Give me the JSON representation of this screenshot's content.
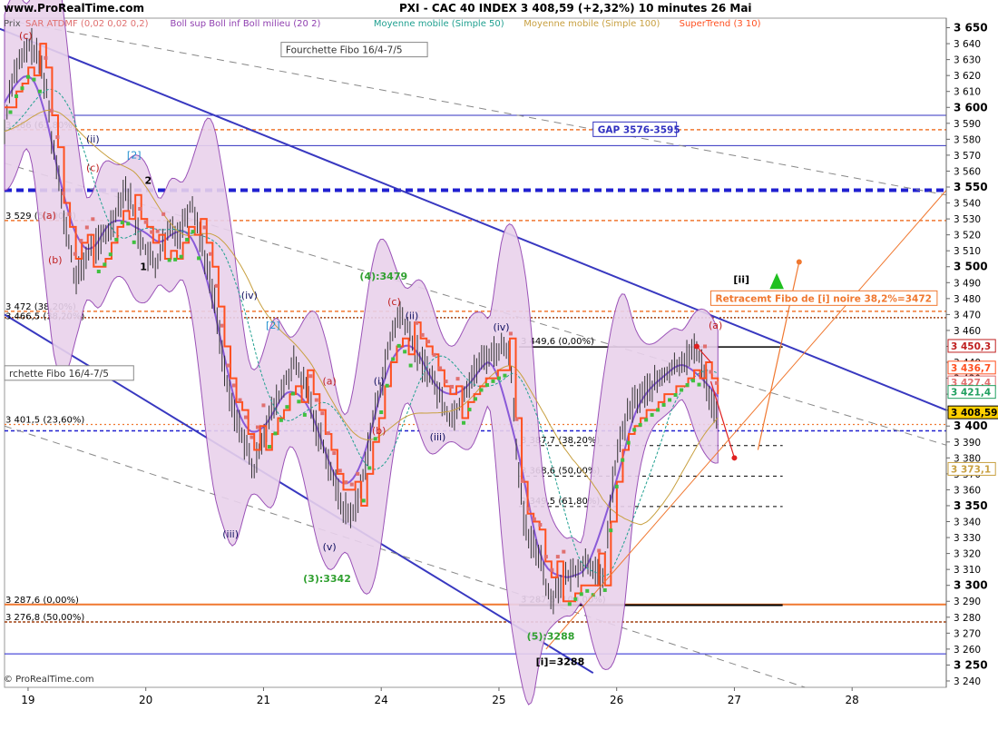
{
  "header": {
    "site": "www.ProRealTime.com",
    "title": "PXI - CAC 40 INDEX     3 408,59  (+2,32%)     10 minutes  26 Mai",
    "price_label": "Prix",
    "footer": "© ProRealTime.com"
  },
  "legend": [
    {
      "label": "SAR ATDMF (0,02 0,02 0,2)",
      "color": "#e07070"
    },
    {
      "label": "Boll sup Boll inf Boll milieu (20 2)",
      "color": "#9040b0"
    },
    {
      "label": "Moyenne mobile (Simple 50)",
      "color": "#20a090"
    },
    {
      "label": "Moyenne mobile (Simple 100)",
      "color": "#c8a040"
    },
    {
      "label": "SuperTrend (3 10)",
      "color": "#ff5020"
    }
  ],
  "chart_data": {
    "type": "line",
    "title": "PXI - CAC 40 INDEX",
    "x_ticks": [
      "19",
      "20",
      "21",
      "24",
      "25",
      "26",
      "27",
      "28"
    ],
    "y_ticks": [
      3240,
      3250,
      3260,
      3270,
      3280,
      3290,
      3300,
      3310,
      3320,
      3330,
      3340,
      3350,
      3360,
      3370,
      3380,
      3390,
      3400,
      3410,
      3420,
      3430,
      3440,
      3450,
      3460,
      3470,
      3480,
      3490,
      3500,
      3510,
      3520,
      3530,
      3540,
      3550,
      3560,
      3570,
      3580,
      3590,
      3600,
      3610,
      3620,
      3630,
      3640,
      3650
    ],
    "y_bold_ticks": [
      3250,
      3300,
      3350,
      3400,
      3450,
      3500,
      3550,
      3600,
      3650
    ],
    "ylim": [
      3236,
      3656
    ],
    "xlim": [
      0,
      8
    ],
    "price_path": [
      [
        0.0,
        3585
      ],
      [
        0.05,
        3615
      ],
      [
        0.1,
        3625
      ],
      [
        0.15,
        3630
      ],
      [
        0.22,
        3640
      ],
      [
        0.3,
        3628
      ],
      [
        0.36,
        3610
      ],
      [
        0.4,
        3580
      ],
      [
        0.46,
        3560
      ],
      [
        0.5,
        3528
      ],
      [
        0.55,
        3515
      ],
      [
        0.6,
        3490
      ],
      [
        0.66,
        3500
      ],
      [
        0.72,
        3510
      ],
      [
        0.8,
        3515
      ],
      [
        0.88,
        3522
      ],
      [
        0.95,
        3535
      ],
      [
        1.02,
        3550
      ],
      [
        1.08,
        3540
      ],
      [
        1.14,
        3520
      ],
      [
        1.2,
        3510
      ],
      [
        1.28,
        3500
      ],
      [
        1.35,
        3515
      ],
      [
        1.42,
        3525
      ],
      [
        1.48,
        3520
      ],
      [
        1.55,
        3535
      ],
      [
        1.6,
        3540
      ],
      [
        1.66,
        3520
      ],
      [
        1.72,
        3500
      ],
      [
        1.78,
        3480
      ],
      [
        1.84,
        3450
      ],
      [
        1.9,
        3420
      ],
      [
        1.96,
        3405
      ],
      [
        2.02,
        3395
      ],
      [
        2.08,
        3380
      ],
      [
        2.12,
        3370
      ],
      [
        2.16,
        3385
      ],
      [
        2.22,
        3400
      ],
      [
        2.28,
        3410
      ],
      [
        2.34,
        3420
      ],
      [
        2.4,
        3430
      ],
      [
        2.46,
        3440
      ],
      [
        2.52,
        3430
      ],
      [
        2.58,
        3420
      ],
      [
        2.64,
        3400
      ],
      [
        2.7,
        3390
      ],
      [
        2.76,
        3375
      ],
      [
        2.82,
        3360
      ],
      [
        2.88,
        3348
      ],
      [
        2.94,
        3344
      ],
      [
        3.0,
        3352
      ],
      [
        3.06,
        3375
      ],
      [
        3.12,
        3400
      ],
      [
        3.18,
        3420
      ],
      [
        3.24,
        3440
      ],
      [
        3.3,
        3460
      ],
      [
        3.36,
        3470
      ],
      [
        3.42,
        3462
      ],
      [
        3.48,
        3450
      ],
      [
        3.54,
        3440
      ],
      [
        3.6,
        3435
      ],
      [
        3.66,
        3425
      ],
      [
        3.72,
        3415
      ],
      [
        3.78,
        3405
      ],
      [
        3.84,
        3410
      ],
      [
        3.9,
        3420
      ],
      [
        3.96,
        3430
      ],
      [
        4.04,
        3440
      ],
      [
        4.12,
        3445
      ],
      [
        4.2,
        3448
      ],
      [
        4.26,
        3450
      ],
      [
        4.3,
        3440
      ],
      [
        4.34,
        3395
      ],
      [
        4.38,
        3360
      ],
      [
        4.42,
        3335
      ],
      [
        4.48,
        3325
      ],
      [
        4.55,
        3320
      ],
      [
        4.6,
        3300
      ],
      [
        4.64,
        3290
      ],
      [
        4.7,
        3300
      ],
      [
        4.78,
        3305
      ],
      [
        4.86,
        3310
      ],
      [
        4.94,
        3315
      ],
      [
        5.0,
        3312
      ],
      [
        5.04,
        3305
      ],
      [
        5.08,
        3300
      ],
      [
        5.12,
        3330
      ],
      [
        5.16,
        3360
      ],
      [
        5.2,
        3380
      ],
      [
        5.26,
        3400
      ],
      [
        5.34,
        3415
      ],
      [
        5.42,
        3420
      ],
      [
        5.5,
        3425
      ],
      [
        5.58,
        3430
      ],
      [
        5.66,
        3435
      ],
      [
        5.74,
        3440
      ],
      [
        5.82,
        3445
      ],
      [
        5.88,
        3448
      ],
      [
        5.92,
        3440
      ],
      [
        5.95,
        3432
      ],
      [
        5.98,
        3420
      ],
      [
        6.02,
        3412
      ],
      [
        6.06,
        3408
      ]
    ],
    "channel_lines": [
      {
        "from": [
          -0.4,
          3660
        ],
        "to": [
          8.0,
          3410
        ],
        "color": "#3838c0",
        "dash": "solid",
        "width": 2
      },
      {
        "from": [
          0.0,
          3470
        ],
        "to": [
          5.0,
          3245
        ],
        "color": "#3838c0",
        "dash": "solid",
        "width": 2
      },
      {
        "from": [
          0.0,
          3565
        ],
        "to": [
          8.0,
          3388
        ],
        "color": "#888888",
        "dash": "8,6",
        "width": 1
      },
      {
        "from": [
          0.0,
          3400
        ],
        "to": [
          6.8,
          3236
        ],
        "color": "#888888",
        "dash": "8,6",
        "width": 1
      },
      {
        "from": [
          0.0,
          3655
        ],
        "to": [
          8.0,
          3545
        ],
        "color": "#888888",
        "dash": "8,6",
        "width": 1
      }
    ],
    "horizontal_levels": [
      {
        "y": 3595,
        "color": "#3030c0",
        "dash": "solid",
        "width": 1
      },
      {
        "y": 3576,
        "color": "#3030c0",
        "dash": "solid",
        "width": 1
      },
      {
        "y": 3586,
        "color": "#f07830",
        "dash": "4,3",
        "width": 1.5
      },
      {
        "y": 3548,
        "color": "#2020d0",
        "dash": "8,5",
        "width": 4
      },
      {
        "y": 3529,
        "color": "#f07830",
        "dash": "4,3",
        "width": 1.5
      },
      {
        "y": 3472,
        "color": "#f07830",
        "dash": "4,3",
        "width": 1.5
      },
      {
        "y": 3468,
        "color": "#a04010",
        "dash": "2,2",
        "width": 1.5
      },
      {
        "y": 3401,
        "color": "#f07830",
        "dash": "2,3",
        "width": 1.2
      },
      {
        "y": 3397,
        "color": "#2020d0",
        "dash": "4,3",
        "width": 1.5
      },
      {
        "y": 3288,
        "color": "#f07830",
        "dash": "solid",
        "width": 2
      },
      {
        "y": 3277,
        "color": "#a04010",
        "dash": "3,2",
        "width": 1.5
      },
      {
        "y": 3257,
        "color": "#2020d0",
        "dash": "solid",
        "width": 1
      }
    ],
    "fib_levels_local": [
      {
        "y": 3449.6,
        "x0": 4.37,
        "x1": 6.61,
        "color": "#000000",
        "width": 1.5,
        "dash": "solid",
        "label": "3 449,6 (0,00%)"
      },
      {
        "y": 3387.7,
        "x0": 4.37,
        "x1": 6.61,
        "color": "#000000",
        "width": 1,
        "dash": "4,4",
        "label": "3 387,7 (38,20%)"
      },
      {
        "y": 3368.6,
        "x0": 4.37,
        "x1": 6.61,
        "color": "#000000",
        "width": 1,
        "dash": "4,4",
        "label": "3 368,6 (50,00%)"
      },
      {
        "y": 3349.5,
        "x0": 4.37,
        "x1": 6.61,
        "color": "#000000",
        "width": 1,
        "dash": "4,4",
        "label": "3 349,5 (61,80%)"
      },
      {
        "y": 3287.6,
        "x0": 4.37,
        "x1": 6.61,
        "color": "#000000",
        "width": 2,
        "dash": "solid",
        "label": "3 287,6 (100,00%)"
      }
    ],
    "left_level_labels": [
      {
        "y": 3586,
        "text": "3 586 (61,80%)"
      },
      {
        "y": 3529,
        "text": "3 529 (50,00%)"
      },
      {
        "y": 3472,
        "text": "3 472 (38,20%)"
      },
      {
        "y": 3466,
        "text": "3 466,5 (38,20%)"
      },
      {
        "y": 3401,
        "text": "3 401,5 (23,60%)"
      },
      {
        "y": 3288,
        "text": "3 287,6 (0,00%)"
      },
      {
        "y": 3277,
        "text": "3 276,8 (50,00%)"
      }
    ],
    "wave_labels": [
      {
        "x": 0.18,
        "y": 3643,
        "text": "(c)",
        "color": "#c02020"
      },
      {
        "x": 0.75,
        "y": 3578,
        "text": "(ii)",
        "color": "#101060"
      },
      {
        "x": 1.1,
        "y": 3568,
        "text": "[2]",
        "color": "#2090d0"
      },
      {
        "x": 0.75,
        "y": 3560,
        "text": "(c)",
        "color": "#c02020"
      },
      {
        "x": 0.38,
        "y": 3530,
        "text": "(a)",
        "color": "#c02020"
      },
      {
        "x": 0.43,
        "y": 3502,
        "text": "(b)",
        "color": "#c02020"
      },
      {
        "x": 1.22,
        "y": 3552,
        "text": "2",
        "color": "#000000"
      },
      {
        "x": 1.18,
        "y": 3498,
        "text": "1",
        "color": "#000000"
      },
      {
        "x": 2.08,
        "y": 3480,
        "text": "(iv)",
        "color": "#101060"
      },
      {
        "x": 2.28,
        "y": 3461,
        "text": "[2]",
        "color": "#2090d0"
      },
      {
        "x": 3.31,
        "y": 3476,
        "text": "(c)",
        "color": "#c02020"
      },
      {
        "x": 3.46,
        "y": 3467,
        "text": "(ii)",
        "color": "#101060"
      },
      {
        "x": 3.18,
        "y": 3395,
        "text": "(b)",
        "color": "#c02020"
      },
      {
        "x": 2.76,
        "y": 3426,
        "text": "(a)",
        "color": "#c02020"
      },
      {
        "x": 3.18,
        "y": 3426,
        "text": "(i)",
        "color": "#101060"
      },
      {
        "x": 3.68,
        "y": 3391,
        "text": "(iii)",
        "color": "#101060"
      },
      {
        "x": 4.22,
        "y": 3460,
        "text": "(iv)",
        "color": "#101060"
      },
      {
        "x": 3.22,
        "y": 3492,
        "text": "(4):3479",
        "color": "#30a030"
      },
      {
        "x": 2.74,
        "y": 3302,
        "text": "(3):3342",
        "color": "#30a030"
      },
      {
        "x": 2.76,
        "y": 3322,
        "text": "(v)",
        "color": "#101060"
      },
      {
        "x": 1.92,
        "y": 3330,
        "text": "(iii)",
        "color": "#101060"
      },
      {
        "x": 4.64,
        "y": 3266,
        "text": "(5):3288",
        "color": "#30a030"
      },
      {
        "x": 4.72,
        "y": 3250,
        "text": "[i]=3288",
        "color": "#000000"
      },
      {
        "x": 6.26,
        "y": 3490,
        "text": "[ii]",
        "color": "#000000"
      },
      {
        "x": 6.04,
        "y": 3461,
        "text": "(a)",
        "color": "#c02020"
      }
    ],
    "annotations": {
      "gap_box": {
        "x": 5.0,
        "y": 3584,
        "text": "GAP 3576-3595"
      },
      "fibo_box_top": {
        "x": 2.35,
        "y": 3634,
        "text": "Fourchette Fibo 16/4-7/5"
      },
      "fibo_box_left": {
        "x": 0.0,
        "y": 3431,
        "text": "rchette Fibo 16/4-7/5"
      },
      "retr_box": {
        "x": 6.0,
        "y": 3478,
        "text": "Retracemt Fibo de [i] noire 38,2%=3472"
      }
    },
    "right_price_tags": [
      {
        "y": 3450.3,
        "text": "3 450,3",
        "color": "#c02020"
      },
      {
        "y": 3436.7,
        "text": "3 436,7",
        "color": "#ff5020"
      },
      {
        "y": 3427.4,
        "text": "3 427,4",
        "color": "#e07070"
      },
      {
        "y": 3421.4,
        "text": "3 421,4",
        "color": "#20a060"
      },
      {
        "y": 3408.59,
        "text": "3 408,59",
        "color": "#000000"
      },
      {
        "y": 3373.1,
        "text": "3 373,1",
        "color": "#c8a040"
      }
    ]
  }
}
